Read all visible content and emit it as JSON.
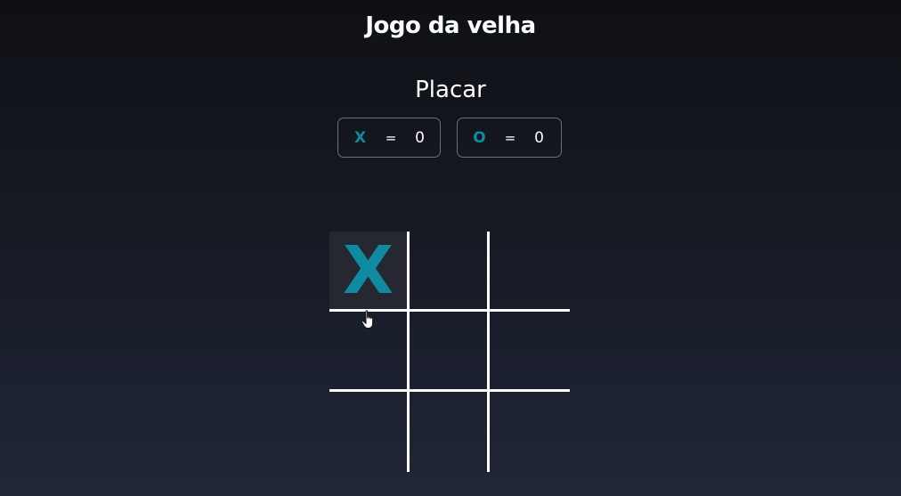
{
  "title": "Jogo da velha",
  "scoreboard": {
    "title": "Placar",
    "players": [
      {
        "symbol": "X",
        "equals": "=",
        "score": "0"
      },
      {
        "symbol": "O",
        "equals": "=",
        "score": "0"
      }
    ]
  },
  "board": {
    "cells": [
      "X",
      "",
      "",
      "",
      "",
      "",
      "",
      "",
      ""
    ],
    "hovered_cell": 0
  },
  "colors": {
    "accent": "#0f8aa0",
    "lines": "#ffffff",
    "hover": "#252830"
  },
  "icons": {
    "cursor": "hand-pointer-icon"
  }
}
